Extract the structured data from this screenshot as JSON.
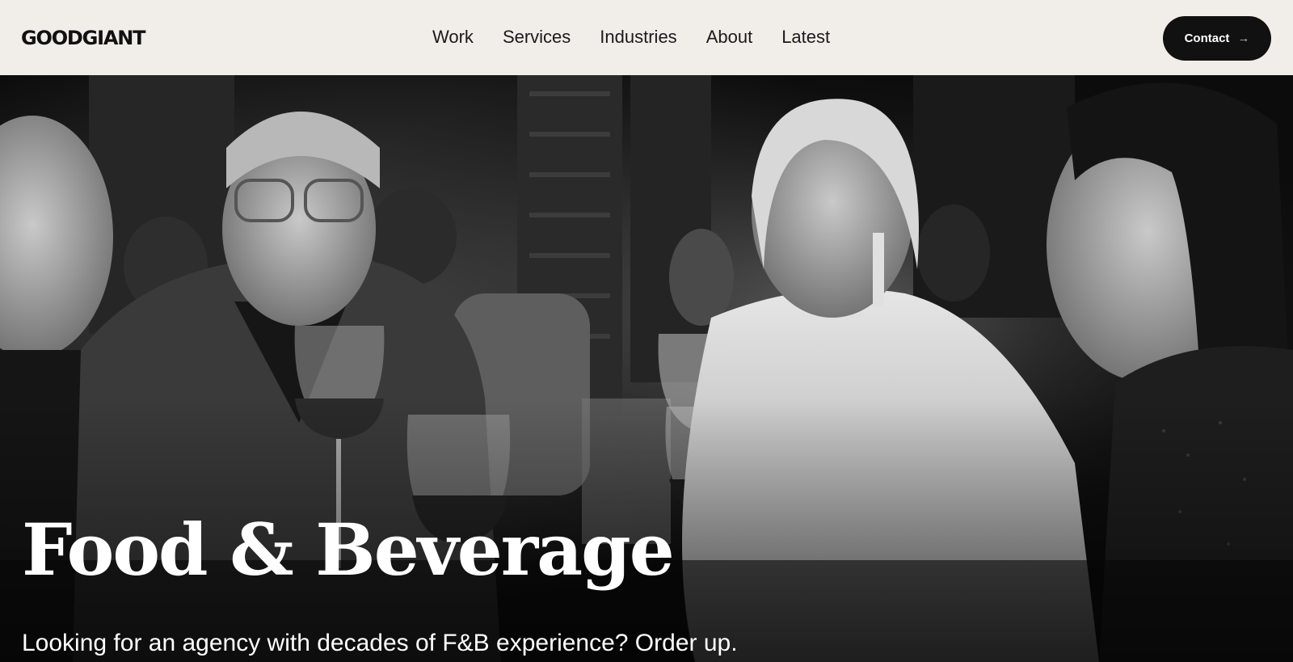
{
  "header": {
    "logo": "GOODGIANT",
    "nav": [
      "Work",
      "Services",
      "Industries",
      "About",
      "Latest"
    ],
    "contact_label": "Contact",
    "contact_icon": "arrow-right-icon"
  },
  "hero": {
    "title": "Food & Beverage",
    "subtitle": "Looking for an agency with decades of F&B experience? Order up.",
    "image_style": "black-and-white photo"
  },
  "colors": {
    "header_bg": "#f1eeea",
    "text_dark": "#111111",
    "button_bg": "#111111",
    "hero_text": "#ffffff"
  }
}
